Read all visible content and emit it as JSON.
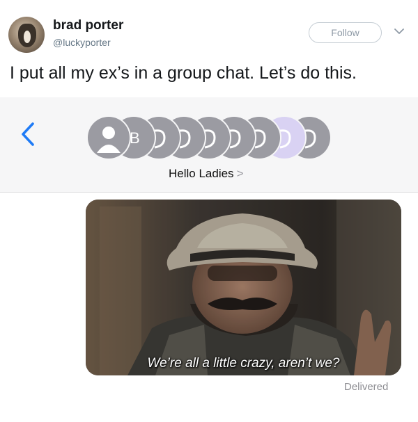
{
  "tweet": {
    "display_name": "brad porter",
    "handle": "@luckyporter",
    "follow_label": "Follow",
    "text": "I put all my ex’s in a group chat. Let’s do this."
  },
  "chat": {
    "group_name": "Hello Ladies",
    "title_chevron": ">",
    "avatar_letters": [
      "",
      "B",
      "",
      "",
      "",
      "",
      "",
      "",
      ""
    ],
    "accent_color": "#1f7bf6",
    "selected_avatar_color": "#d9d2f3"
  },
  "message": {
    "subtitle": "We’re all a little crazy, aren’t we?",
    "status": "Delivered"
  },
  "icons": {
    "back": "chevron-left-icon",
    "more": "chevron-down-icon"
  }
}
